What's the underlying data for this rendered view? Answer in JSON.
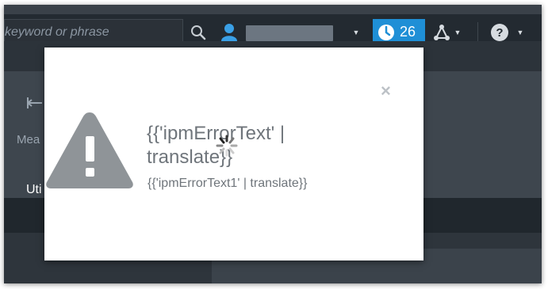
{
  "header": {
    "search": {
      "placeholder": "keyword or phrase"
    },
    "notifications": {
      "count": "26"
    }
  },
  "background": {
    "tool_label": "Mea",
    "section_label": "Uti"
  },
  "modal": {
    "title": "{{'ipmErrorText' | translate}}",
    "subtitle": "{{'ipmErrorText1' | translate}}",
    "close_symbol": "×"
  },
  "colors": {
    "accent": "#1f8fd6",
    "warning_gray": "#6f757b",
    "user_icon": "#3aa0e6"
  }
}
